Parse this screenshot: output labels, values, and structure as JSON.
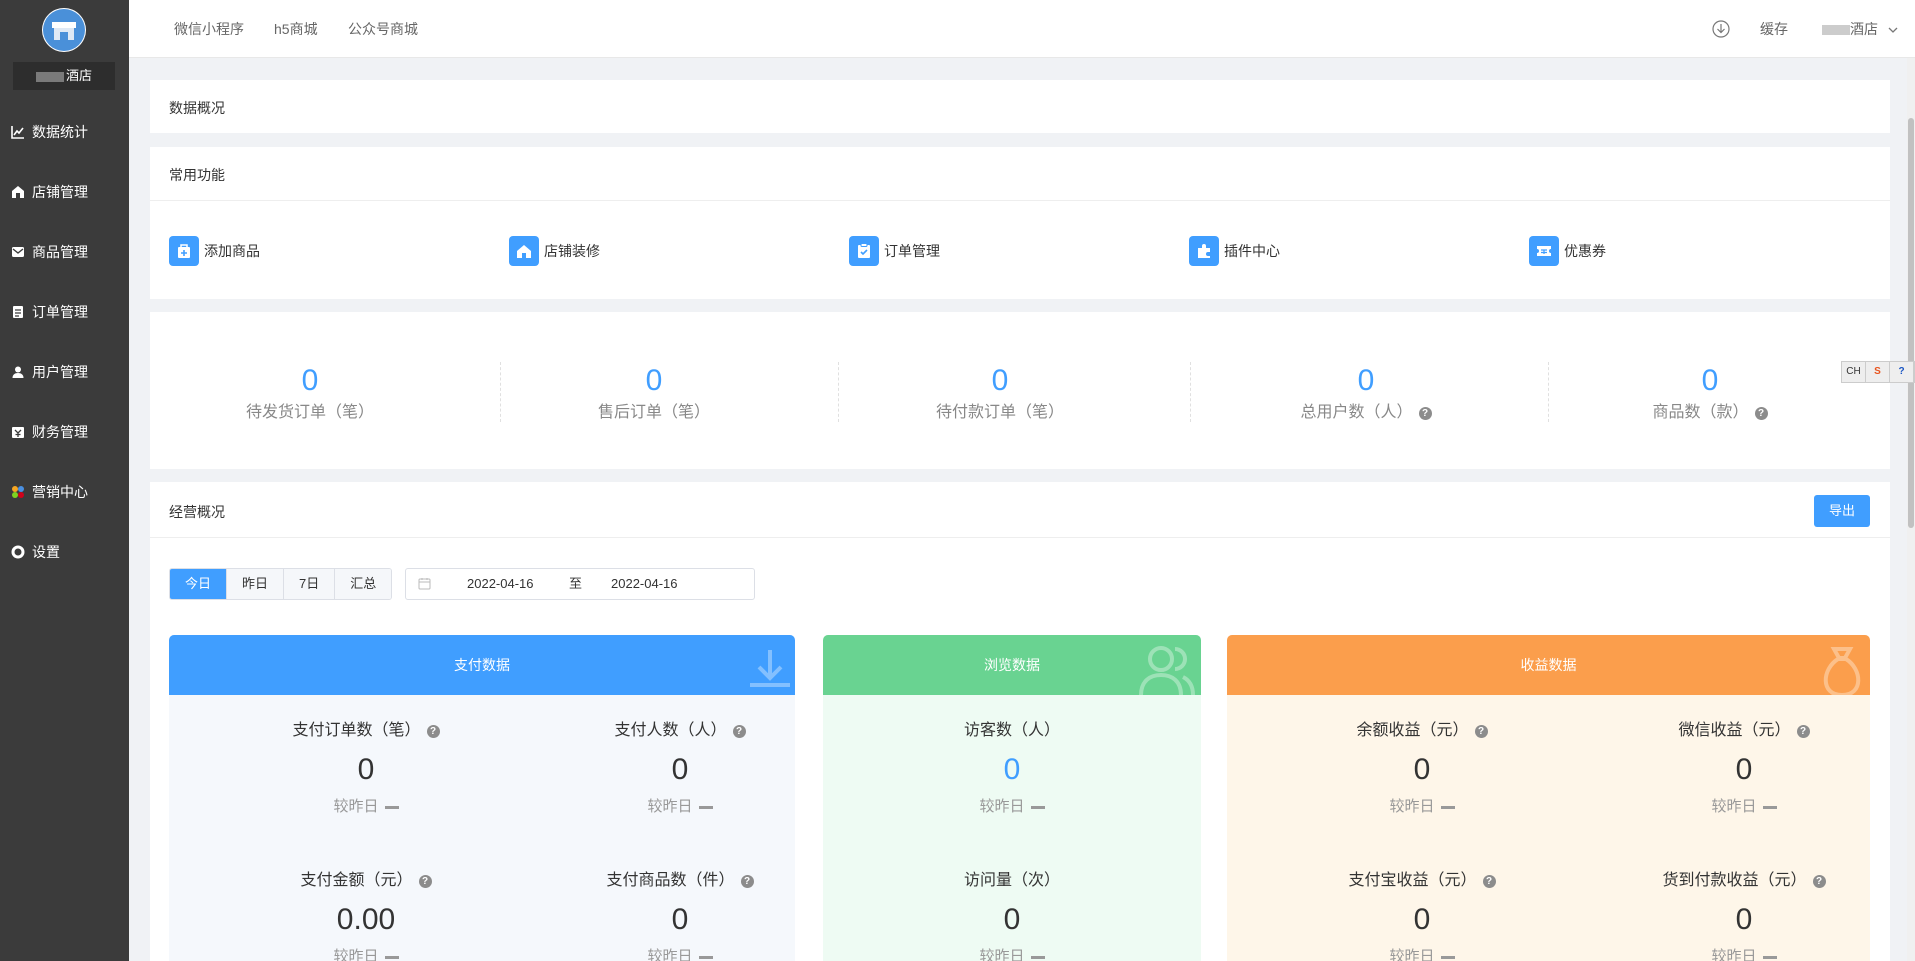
{
  "sidebar": {
    "shop_name": "酒店",
    "items": [
      {
        "label": "数据统计",
        "icon": "line-chart-icon"
      },
      {
        "label": "店铺管理",
        "icon": "shop-icon"
      },
      {
        "label": "商品管理",
        "icon": "envelope-icon"
      },
      {
        "label": "订单管理",
        "icon": "clipboard-icon"
      },
      {
        "label": "用户管理",
        "icon": "user-icon"
      },
      {
        "label": "财务管理",
        "icon": "finance-icon"
      },
      {
        "label": "营销中心",
        "icon": "marketing-icon"
      },
      {
        "label": "设置",
        "icon": "gear-icon"
      }
    ]
  },
  "topbar": {
    "links": [
      "微信小程序",
      "h5商城",
      "公众号商城"
    ],
    "cache_label": "缓存",
    "user_name": "酒店"
  },
  "overview": {
    "title": "数据概况"
  },
  "common": {
    "title": "常用功能",
    "items": [
      {
        "label": "添加商品",
        "icon": "add-product-icon"
      },
      {
        "label": "店铺装修",
        "icon": "home-icon"
      },
      {
        "label": "订单管理",
        "icon": "order-icon"
      },
      {
        "label": "插件中心",
        "icon": "plugin-icon"
      },
      {
        "label": "优惠券",
        "icon": "coupon-icon"
      }
    ]
  },
  "stats": [
    {
      "value": "0",
      "label": "待发货订单（笔）",
      "help": false
    },
    {
      "value": "0",
      "label": "售后订单（笔）",
      "help": false
    },
    {
      "value": "0",
      "label": "待付款订单（笔）",
      "help": false
    },
    {
      "value": "0",
      "label": "总用户数（人）",
      "help": true
    },
    {
      "value": "0",
      "label": "商品数（款）",
      "help": true
    }
  ],
  "business": {
    "title": "经营概况",
    "export_label": "导出",
    "ranges": [
      "今日",
      "昨日",
      "7日",
      "汇总"
    ],
    "active_range": "今日",
    "date_start": "2022-04-16",
    "date_sep": "至",
    "date_end": "2022-04-16"
  },
  "cards": {
    "pay": {
      "title": "支付数据",
      "color": "#409eff",
      "bg": "#f5f8fc",
      "metrics": [
        {
          "label": "支付订单数（笔）",
          "value": "0",
          "cmp": "较昨日"
        },
        {
          "label": "支付人数（人）",
          "value": "0",
          "cmp": "较昨日"
        },
        {
          "label": "支付金额（元）",
          "value": "0.00",
          "cmp": "较昨日"
        },
        {
          "label": "支付商品数（件）",
          "value": "0",
          "cmp": "较昨日"
        }
      ]
    },
    "browse": {
      "title": "浏览数据",
      "color": "#69d391",
      "bg": "#eefbf3",
      "metrics": [
        {
          "label": "访客数（人）",
          "value": "0",
          "cmp": "较昨日"
        },
        {
          "label": "访问量（次）",
          "value": "0",
          "cmp": "较昨日"
        }
      ]
    },
    "income": {
      "title": "收益数据",
      "color": "#fb9e4c",
      "bg": "#fef6e9",
      "metrics": [
        {
          "label": "余额收益（元）",
          "value": "0",
          "cmp": "较昨日"
        },
        {
          "label": "微信收益（元）",
          "value": "0",
          "cmp": "较昨日"
        },
        {
          "label": "支付宝收益（元）",
          "value": "0",
          "cmp": "较昨日"
        },
        {
          "label": "货到付款收益（元）",
          "value": "0",
          "cmp": "较昨日"
        }
      ]
    }
  },
  "float_tools": [
    "CH",
    "S",
    "?"
  ]
}
